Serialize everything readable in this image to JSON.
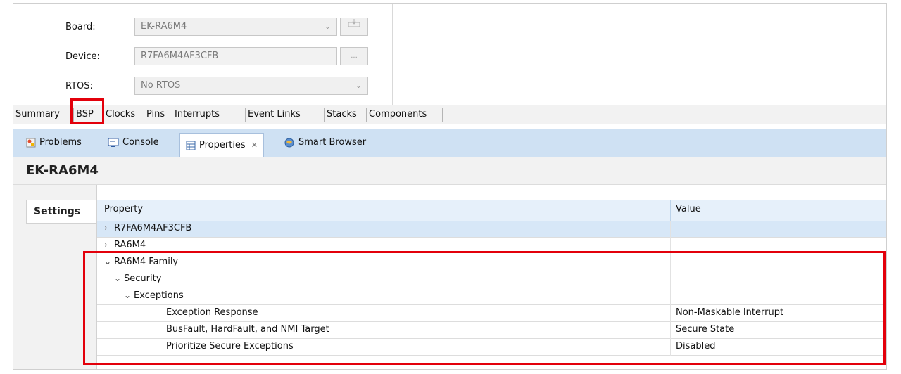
{
  "form": {
    "board_label": "Board:",
    "board_value": "EK-RA6M4",
    "device_label": "Device:",
    "device_value": "R7FA6M4AF3CFB",
    "device_browse": "...",
    "rtos_label": "RTOS:",
    "rtos_value": "No RTOS"
  },
  "config_tabs": [
    "Summary",
    "BSP",
    "Clocks",
    "Pins",
    "Interrupts",
    "Event Links",
    "Stacks",
    "Components"
  ],
  "view_tabs": {
    "problems": "Problems",
    "console": "Console",
    "properties": "Properties",
    "properties_close": "✕",
    "smart_browser": "Smart Browser"
  },
  "properties": {
    "title": "EK-RA6M4",
    "settings_tab": "Settings",
    "col_property": "Property",
    "col_value": "Value",
    "rows": [
      {
        "label": "R7FA6M4AF3CFB",
        "value": "",
        "twisty": "›",
        "selected": true
      },
      {
        "label": "RA6M4",
        "value": "",
        "twisty": "›"
      },
      {
        "label": "RA6M4 Family",
        "value": "",
        "twisty": "⌄"
      },
      {
        "label": "Security",
        "value": "",
        "twisty": "⌄"
      },
      {
        "label": "Exceptions",
        "value": "",
        "twisty": "⌄"
      },
      {
        "label": "Exception Response",
        "value": "Non-Maskable Interrupt"
      },
      {
        "label": "BusFault, HardFault, and NMI Target",
        "value": "Secure State"
      },
      {
        "label": "Prioritize Secure Exceptions",
        "value": "Disabled"
      }
    ]
  },
  "colors": {
    "highlight": "#e3000b",
    "header_blue": "#cfe1f3",
    "selection": "#d7e7f7"
  }
}
